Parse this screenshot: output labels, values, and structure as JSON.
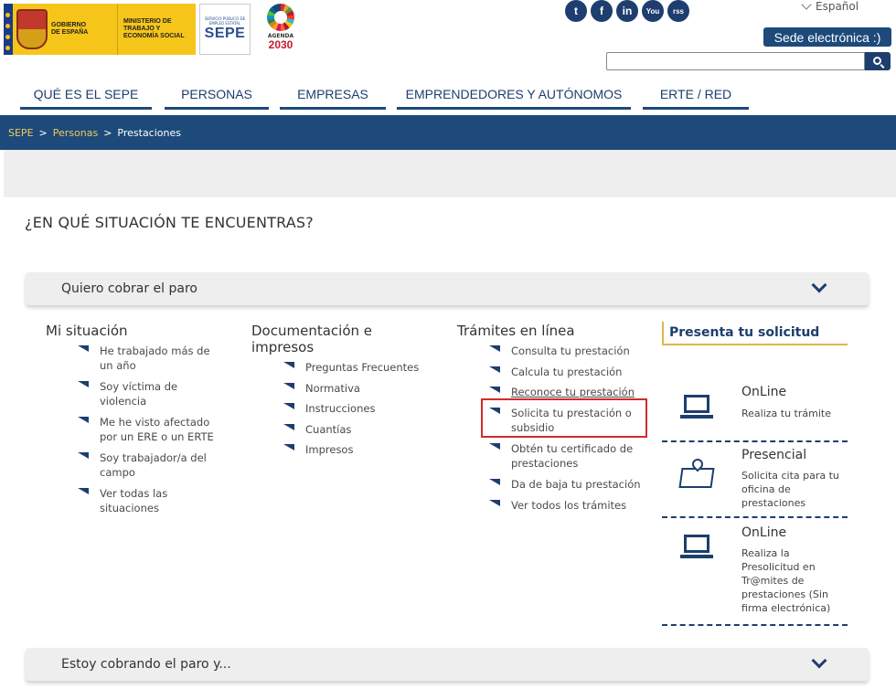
{
  "header": {
    "logos": {
      "gobierno": "GOBIERNO DE ESPAÑA",
      "ministerio": "MINISTERIO DE TRABAJO Y ECONOMÍA SOCIAL",
      "sepe_small": "SERVICIO PÚBLICO DE EMPLEO ESTATAL",
      "sepe": "SEPE",
      "agenda": "AGENDA",
      "agenda_year": "2030"
    },
    "social": [
      "t",
      "f",
      "in",
      "You",
      "rss"
    ],
    "social_icons": [
      "twitter-icon",
      "facebook-icon",
      "linkedin-icon",
      "youtube-icon",
      "rss-icon"
    ],
    "language": "Español",
    "sede_button": "Sede electrónica :)",
    "search_placeholder": ""
  },
  "nav": {
    "items": [
      {
        "label": "QUÉ ES EL SEPE"
      },
      {
        "label": "PERSONAS"
      },
      {
        "label": "EMPRESAS"
      },
      {
        "label": "EMPRENDEDORES Y AUTÓNOMOS"
      },
      {
        "label": "ERTE / RED"
      }
    ]
  },
  "breadcrumb": {
    "items": [
      "SEPE",
      "Personas",
      "Prestaciones"
    ],
    "separator": ">"
  },
  "main": {
    "question": "¿EN QUÉ SITUACIÓN TE ENCUENTRAS?",
    "accordion_open": "Quiero cobrar el paro",
    "accordion_closed": "Estoy cobrando el paro y...",
    "columns": [
      {
        "title": "Mi situación",
        "items": [
          "He trabajado más de un año",
          "Soy víctima de violencia",
          "Me he visto afectado por un ERE o un ERTE",
          "Soy trabajador/a del campo",
          "Ver todas las situaciones"
        ]
      },
      {
        "title": "Documentación e impresos",
        "items": [
          "Preguntas Frecuentes",
          "Normativa",
          "Instrucciones",
          "Cuantías",
          "Impresos"
        ]
      },
      {
        "title": "Trámites en línea",
        "items": [
          "Consulta tu prestación",
          "Calcula tu prestación",
          "Reconoce tu prestación",
          "Solicita tu prestación o subsidio",
          "Obtén tu certificado de prestaciones",
          "Da de baja tu prestación",
          "Ver todos los trámites"
        ]
      }
    ],
    "side": {
      "title": "Presenta tu solicitud",
      "blocks": [
        {
          "title": "OnLine",
          "text": "Realiza tu trámite",
          "icon": "laptop-icon"
        },
        {
          "title": "Presencial",
          "text": "Solicita cita para tu oficina de prestaciones",
          "icon": "map-icon"
        },
        {
          "title": "OnLine",
          "text": "Realiza la Presolicitud en Tr@mites de prestaciones (Sin firma electrónica)",
          "icon": "laptop-icon"
        }
      ]
    }
  },
  "colors": {
    "primary": "#1d4a7a",
    "accent_gold": "#e3b44b",
    "highlight": "#d22b2b"
  }
}
